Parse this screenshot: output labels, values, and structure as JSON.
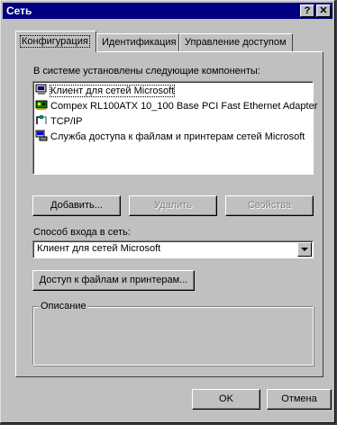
{
  "window": {
    "title": "Сеть",
    "help_btn": "?",
    "close_btn": "✕"
  },
  "tabs": [
    {
      "label": "Конфигурация",
      "active": true
    },
    {
      "label": "Идентификация",
      "active": false
    },
    {
      "label": "Управление доступом",
      "active": false
    }
  ],
  "config": {
    "components_label": "В системе установлены следующие компоненты:",
    "components": [
      {
        "label": "Клиент для сетей Microsoft",
        "icon": "network-client-icon",
        "selected": true
      },
      {
        "label": "Compex RL100ATX 10_100 Base PCI Fast Ethernet Adapter",
        "icon": "network-adapter-icon",
        "selected": false
      },
      {
        "label": "TCP/IP",
        "icon": "protocol-icon",
        "selected": false
      },
      {
        "label": "Служба доступа к файлам и принтерам сетей Microsoft",
        "icon": "file-printer-sharing-icon",
        "selected": false
      }
    ],
    "add_button": "Добавить...",
    "remove_button": "Удалить",
    "properties_button": "Свойства",
    "logon_label": "Способ входа в сеть:",
    "logon_value": "Клиент для сетей Microsoft",
    "file_printer_button": "Доступ к файлам и принтерам...",
    "description_legend": "Описание"
  },
  "footer": {
    "ok_button": "OK",
    "cancel_button": "Отмена"
  }
}
